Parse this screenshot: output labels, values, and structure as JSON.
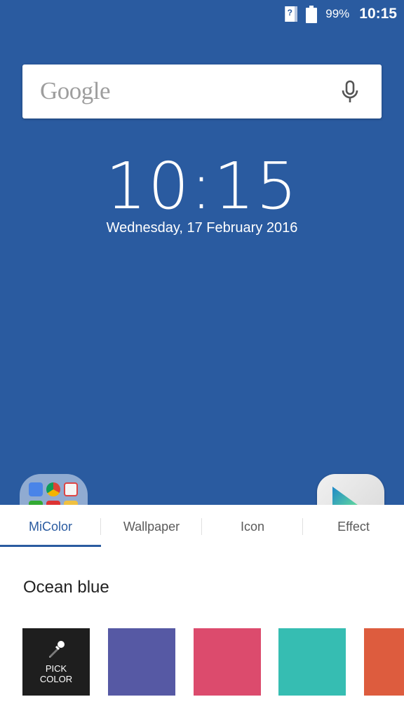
{
  "status_bar": {
    "sim_icon": "sim-unknown-icon",
    "battery_icon": "battery-full-icon",
    "battery_percent": "99%",
    "time": "10:15"
  },
  "search": {
    "logo_text": "Google",
    "mic_icon": "microphone-icon"
  },
  "clock_widget": {
    "time": "10:15",
    "date": "Wednesday, 17 February 2016"
  },
  "dock": {
    "folder_icon": "app-folder-icon",
    "play_store_icon": "play-store-icon"
  },
  "theme_panel": {
    "tabs": [
      {
        "label": "MiColor",
        "active": true
      },
      {
        "label": "Wallpaper",
        "active": false
      },
      {
        "label": "Icon",
        "active": false
      },
      {
        "label": "Effect",
        "active": false
      }
    ],
    "current_theme": "Ocean blue",
    "pick_color": {
      "line1": "PICK",
      "line2": "COLOR",
      "icon": "eyedropper-icon"
    },
    "swatches": [
      {
        "name": "indigo",
        "color": "#5659a4"
      },
      {
        "name": "pink",
        "color": "#dc4b6d"
      },
      {
        "name": "teal",
        "color": "#36bdb2"
      },
      {
        "name": "orange",
        "color": "#dd5c3e"
      }
    ],
    "accent_color": "#2a5ba0"
  }
}
